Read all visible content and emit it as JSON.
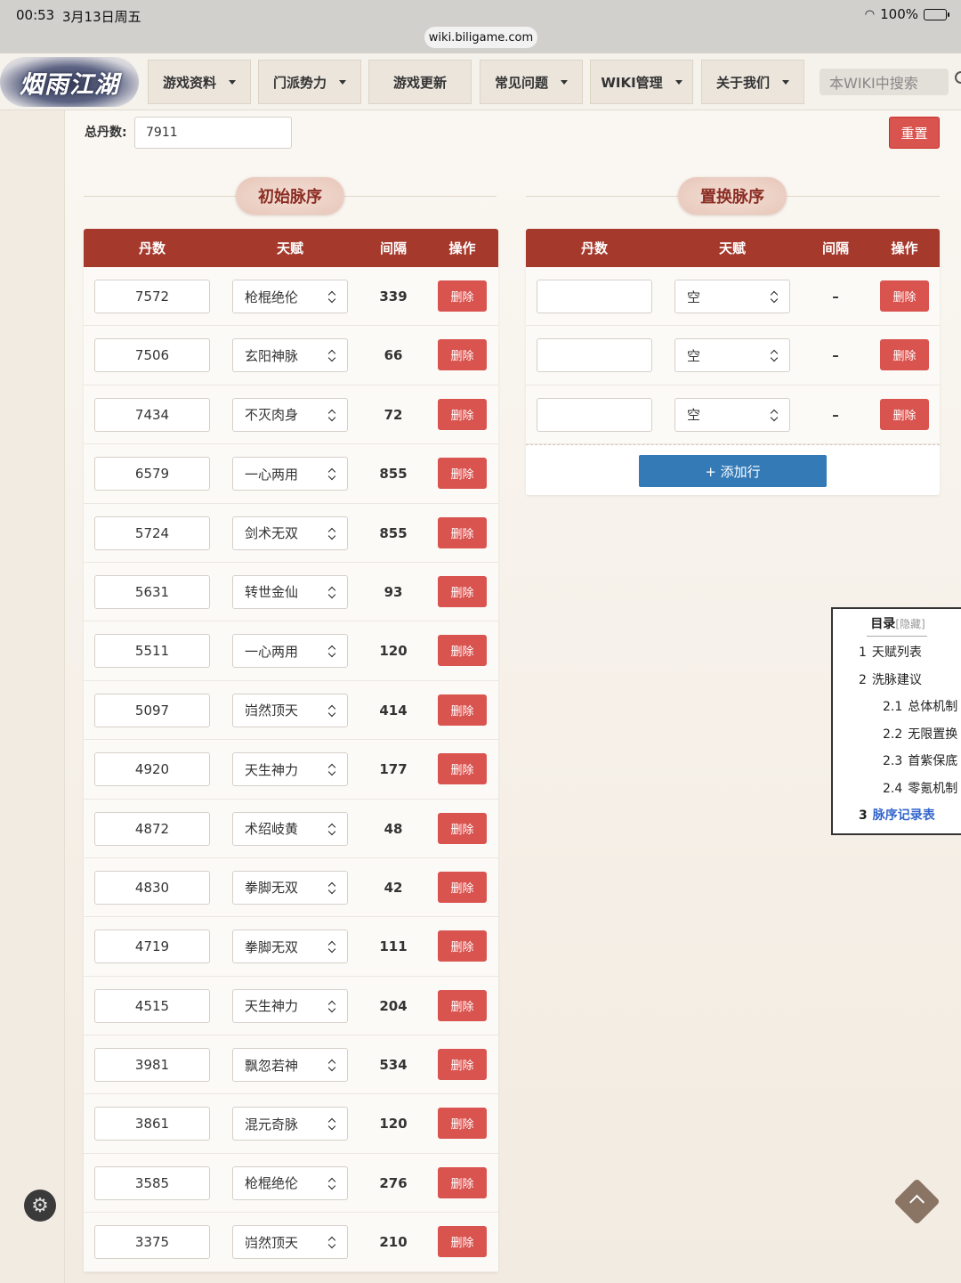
{
  "status_bar": {
    "time": "00:53",
    "date": "3月13日周五",
    "battery": "100%",
    "url": "wiki.biligame.com"
  },
  "nav": {
    "logo_text": "烟雨江湖",
    "items": [
      {
        "label": "游戏资料",
        "dropdown": true
      },
      {
        "label": "门派势力",
        "dropdown": true
      },
      {
        "label": "游戏更新",
        "dropdown": false
      },
      {
        "label": "常见问题",
        "dropdown": true
      },
      {
        "label": "WIKI管理",
        "dropdown": true
      },
      {
        "label": "关于我们",
        "dropdown": true
      }
    ],
    "search_placeholder": "本WIKI中搜索"
  },
  "calculator": {
    "total_label": "总丹数:",
    "total_value": "7911",
    "reset_label": "重置"
  },
  "initial_table": {
    "title": "初始脉序",
    "headers": [
      "丹数",
      "天赋",
      "间隔",
      "操作"
    ],
    "delete_label": "删除",
    "rows": [
      {
        "dan": "7572",
        "talent": "枪棍绝伦",
        "gap": "339"
      },
      {
        "dan": "7506",
        "talent": "玄阳神脉",
        "gap": "66"
      },
      {
        "dan": "7434",
        "talent": "不灭肉身",
        "gap": "72"
      },
      {
        "dan": "6579",
        "talent": "一心两用",
        "gap": "855"
      },
      {
        "dan": "5724",
        "talent": "剑术无双",
        "gap": "855"
      },
      {
        "dan": "5631",
        "talent": "转世金仙",
        "gap": "93"
      },
      {
        "dan": "5511",
        "talent": "一心两用",
        "gap": "120"
      },
      {
        "dan": "5097",
        "talent": "岿然顶天",
        "gap": "414"
      },
      {
        "dan": "4920",
        "talent": "天生神力",
        "gap": "177"
      },
      {
        "dan": "4872",
        "talent": "术绍岐黄",
        "gap": "48"
      },
      {
        "dan": "4830",
        "talent": "拳脚无双",
        "gap": "42"
      },
      {
        "dan": "4719",
        "talent": "拳脚无双",
        "gap": "111"
      },
      {
        "dan": "4515",
        "talent": "天生神力",
        "gap": "204"
      },
      {
        "dan": "3981",
        "talent": "飘忽若神",
        "gap": "534"
      },
      {
        "dan": "3861",
        "talent": "混元奇脉",
        "gap": "120"
      },
      {
        "dan": "3585",
        "talent": "枪棍绝伦",
        "gap": "276"
      },
      {
        "dan": "3375",
        "talent": "岿然顶天",
        "gap": "210"
      }
    ]
  },
  "replace_table": {
    "title": "置换脉序",
    "headers": [
      "丹数",
      "天赋",
      "间隔",
      "操作"
    ],
    "delete_label": "删除",
    "rows": [
      {
        "dan": "",
        "talent": "空",
        "gap": "–"
      },
      {
        "dan": "",
        "talent": "空",
        "gap": "–"
      },
      {
        "dan": "",
        "talent": "空",
        "gap": "–"
      }
    ],
    "add_label": "+ 添加行"
  },
  "toc": {
    "title": "目录",
    "hide_label": "[隐藏]",
    "items": [
      {
        "num": "1",
        "label": "天赋列表",
        "level": 1
      },
      {
        "num": "2",
        "label": "洗脉建议",
        "level": 1
      },
      {
        "num": "2.1",
        "label": "总体机制",
        "level": 2
      },
      {
        "num": "2.2",
        "label": "无限置换",
        "level": 2
      },
      {
        "num": "2.3",
        "label": "首紫保底",
        "level": 2
      },
      {
        "num": "2.4",
        "label": "零氪机制",
        "level": 2
      },
      {
        "num": "3",
        "label": "脉序记录表",
        "level": 1,
        "active": true
      }
    ]
  },
  "colors": {
    "header_red": "#a5392c",
    "danger": "#d9534f",
    "primary": "#337ab7",
    "title_text": "#8b2e24"
  }
}
